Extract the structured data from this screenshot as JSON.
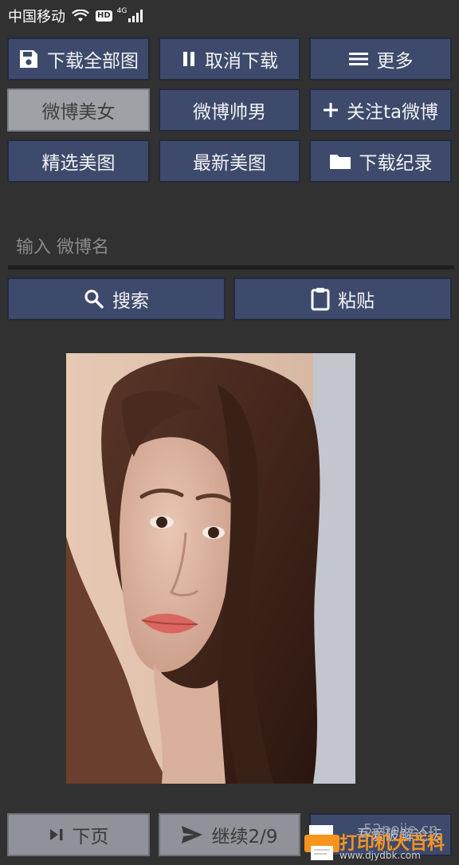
{
  "status_bar": {
    "carrier": "中国移动",
    "hd": "HD",
    "network": "4G"
  },
  "toolbar": {
    "download_all": "下载全部图",
    "cancel_download": "取消下载",
    "more": "更多"
  },
  "categories": {
    "weibo_beauty": "微博美女",
    "weibo_handsome": "微博帅男",
    "follow": "关注ta微博",
    "selected": "精选美图",
    "latest": "最新美图",
    "history": "下载纪录"
  },
  "search": {
    "placeholder": "输入 微博名",
    "search_label": "搜索",
    "paste_label": "粘贴"
  },
  "bottom": {
    "next_page": "下页",
    "continue": "继续2/9",
    "partial_label": "吾爱破解论坛"
  },
  "watermark": {
    "brand": "打印机大百科",
    "url": "www.djydbk.com",
    "faint": "52pojie.cn"
  },
  "colors": {
    "background": "#313131",
    "button": "#3d4a6c",
    "button_inactive": "#9ea1a6",
    "watermark_accent": "#f7941d"
  }
}
